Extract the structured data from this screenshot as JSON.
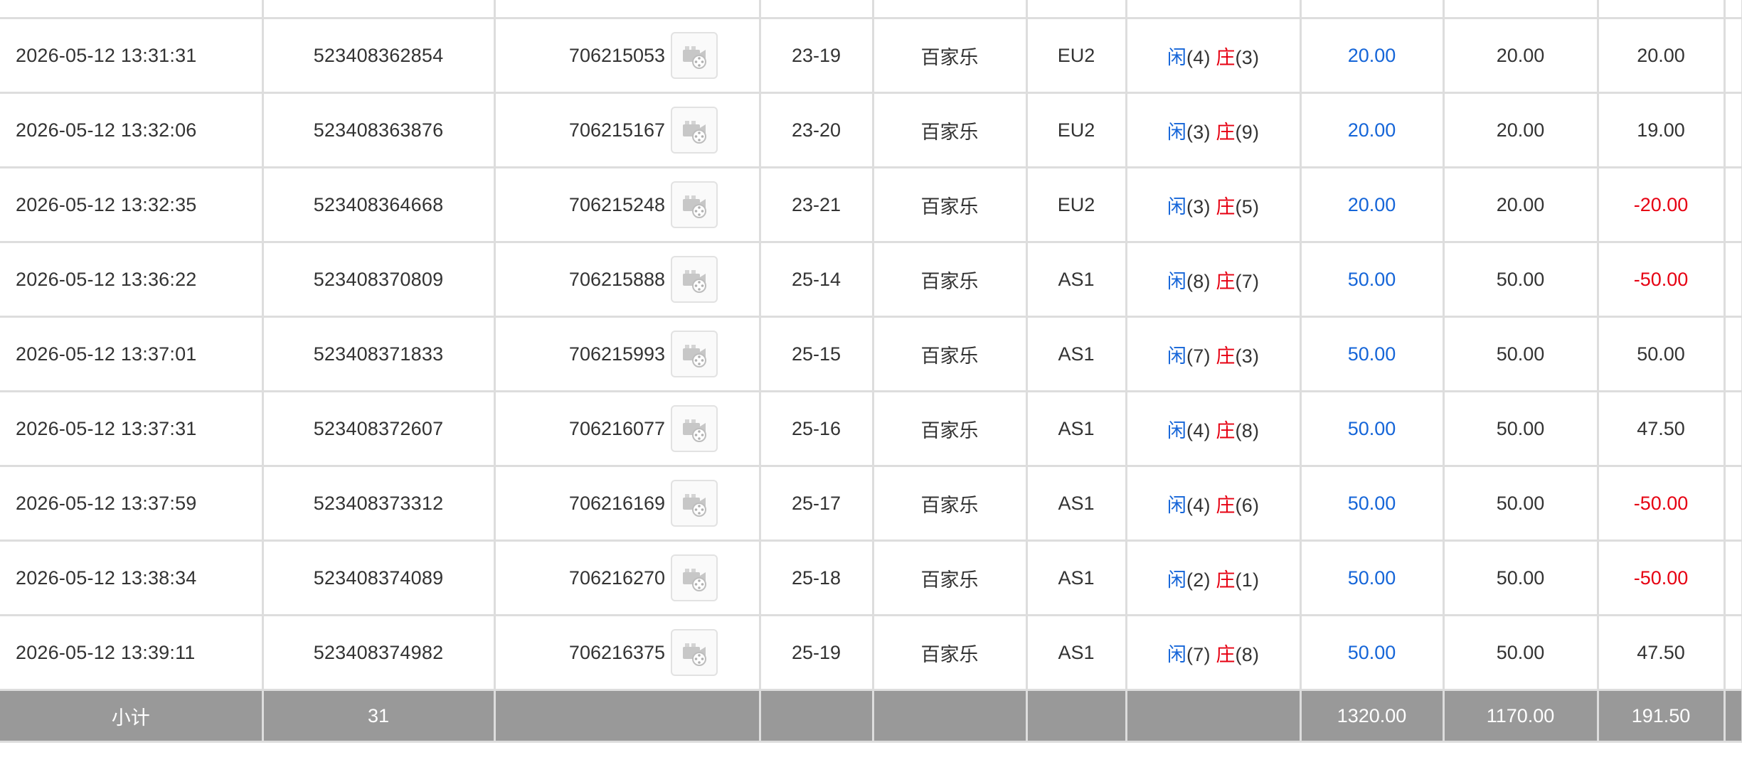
{
  "rows": [
    {
      "time": "2026-05-12 13:31:31",
      "bet_no": "523408362854",
      "round_no": "706215053",
      "shoe": "23-19",
      "game": "百家乐",
      "table": "EU2",
      "player_label": "闲",
      "player_pts": "(4)",
      "banker_label": "庄",
      "banker_pts": "(3)",
      "bet": "20.00",
      "valid": "20.00",
      "winloss": "20.00",
      "winloss_color": "#333333"
    },
    {
      "time": "2026-05-12 13:32:06",
      "bet_no": "523408363876",
      "round_no": "706215167",
      "shoe": "23-20",
      "game": "百家乐",
      "table": "EU2",
      "player_label": "闲",
      "player_pts": "(3)",
      "banker_label": "庄",
      "banker_pts": "(9)",
      "bet": "20.00",
      "valid": "20.00",
      "winloss": "19.00",
      "winloss_color": "#333333"
    },
    {
      "time": "2026-05-12 13:32:35",
      "bet_no": "523408364668",
      "round_no": "706215248",
      "shoe": "23-21",
      "game": "百家乐",
      "table": "EU2",
      "player_label": "闲",
      "player_pts": "(3)",
      "banker_label": "庄",
      "banker_pts": "(5)",
      "bet": "20.00",
      "valid": "20.00",
      "winloss": "-20.00",
      "winloss_color": "#e60012"
    },
    {
      "time": "2026-05-12 13:36:22",
      "bet_no": "523408370809",
      "round_no": "706215888",
      "shoe": "25-14",
      "game": "百家乐",
      "table": "AS1",
      "player_label": "闲",
      "player_pts": "(8)",
      "banker_label": "庄",
      "banker_pts": "(7)",
      "bet": "50.00",
      "valid": "50.00",
      "winloss": "-50.00",
      "winloss_color": "#e60012"
    },
    {
      "time": "2026-05-12 13:37:01",
      "bet_no": "523408371833",
      "round_no": "706215993",
      "shoe": "25-15",
      "game": "百家乐",
      "table": "AS1",
      "player_label": "闲",
      "player_pts": "(7)",
      "banker_label": "庄",
      "banker_pts": "(3)",
      "bet": "50.00",
      "valid": "50.00",
      "winloss": "50.00",
      "winloss_color": "#333333"
    },
    {
      "time": "2026-05-12 13:37:31",
      "bet_no": "523408372607",
      "round_no": "706216077",
      "shoe": "25-16",
      "game": "百家乐",
      "table": "AS1",
      "player_label": "闲",
      "player_pts": "(4)",
      "banker_label": "庄",
      "banker_pts": "(8)",
      "bet": "50.00",
      "valid": "50.00",
      "winloss": "47.50",
      "winloss_color": "#333333"
    },
    {
      "time": "2026-05-12 13:37:59",
      "bet_no": "523408373312",
      "round_no": "706216169",
      "shoe": "25-17",
      "game": "百家乐",
      "table": "AS1",
      "player_label": "闲",
      "player_pts": "(4)",
      "banker_label": "庄",
      "banker_pts": "(6)",
      "bet": "50.00",
      "valid": "50.00",
      "winloss": "-50.00",
      "winloss_color": "#e60012"
    },
    {
      "time": "2026-05-12 13:38:34",
      "bet_no": "523408374089",
      "round_no": "706216270",
      "shoe": "25-18",
      "game": "百家乐",
      "table": "AS1",
      "player_label": "闲",
      "player_pts": "(2)",
      "banker_label": "庄",
      "banker_pts": "(1)",
      "bet": "50.00",
      "valid": "50.00",
      "winloss": "-50.00",
      "winloss_color": "#e60012"
    },
    {
      "time": "2026-05-12 13:39:11",
      "bet_no": "523408374982",
      "round_no": "706216375",
      "shoe": "25-19",
      "game": "百家乐",
      "table": "AS1",
      "player_label": "闲",
      "player_pts": "(7)",
      "banker_label": "庄",
      "banker_pts": "(8)",
      "bet": "50.00",
      "valid": "50.00",
      "winloss": "47.50",
      "winloss_color": "#333333"
    }
  ],
  "subtotal": {
    "label": "小计",
    "count": "31",
    "bet_total": "1320.00",
    "valid_total": "1170.00",
    "winloss_total": "191.50"
  },
  "icons": {
    "detail": "video-replay-icon"
  },
  "colors": {
    "player": "#1565d8",
    "banker": "#e60012",
    "bet_amount": "#1565d8",
    "loss": "#e60012",
    "subtotal_bg": "#999999",
    "grid": "#dddddd"
  }
}
